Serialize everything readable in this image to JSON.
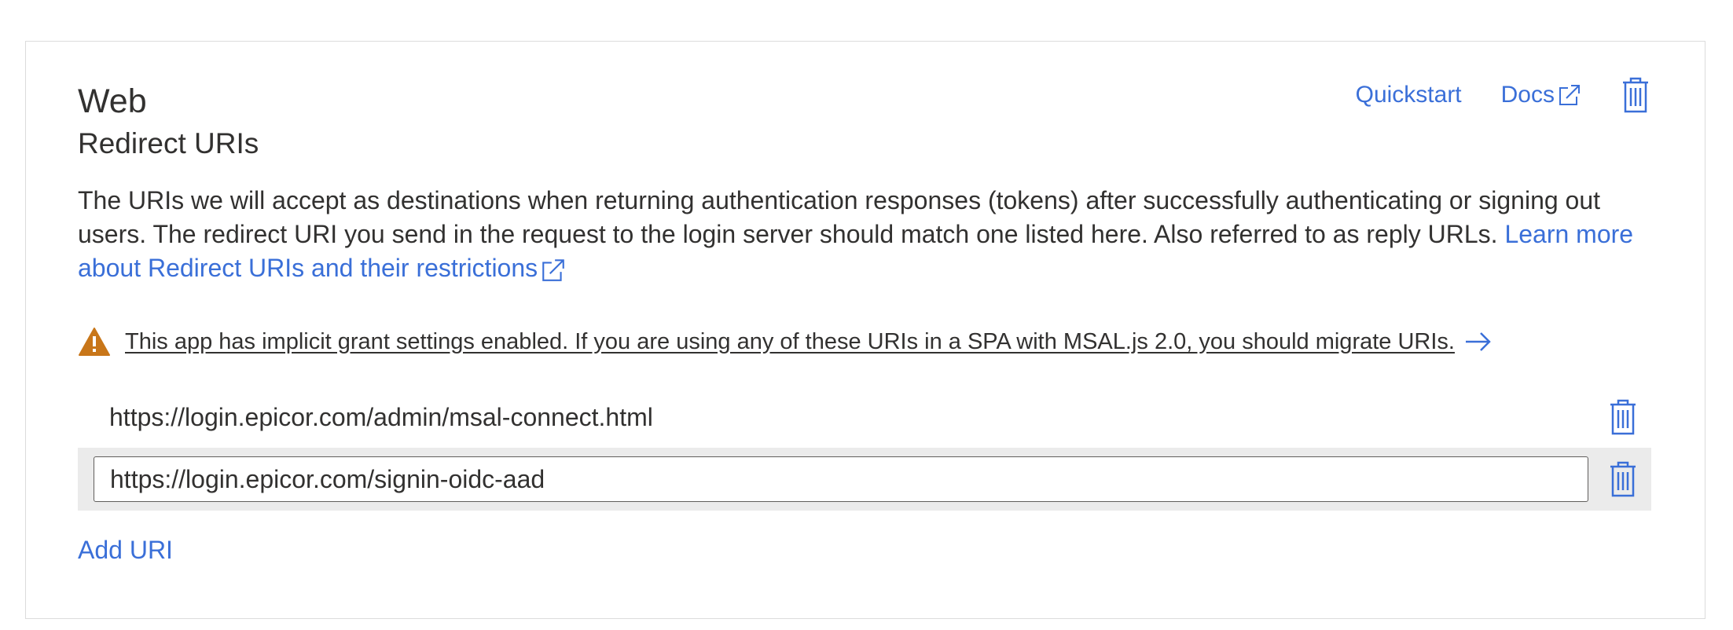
{
  "platform": {
    "title": "Web",
    "section_title": "Redirect URIs"
  },
  "header_actions": {
    "quickstart_label": "Quickstart",
    "docs_label": "Docs"
  },
  "description": {
    "text": "The URIs we will accept as destinations when returning authentication responses (tokens) after successfully authenticating or signing out users. The redirect URI you send in the request to the login server should match one listed here. Also referred to as reply URLs. ",
    "learn_more_label": "Learn more about Redirect URIs and their restrictions"
  },
  "warning": {
    "text": "This app has implicit grant settings enabled. If you are using any of these URIs in a SPA with MSAL.js 2.0, you should migrate URIs."
  },
  "redirect_uris": {
    "static": "https://login.epicor.com/admin/msal-connect.html",
    "editing": "https://login.epicor.com/signin-oidc-aad"
  },
  "add_uri_label": "Add URI",
  "colors": {
    "link": "#3a6fd8",
    "warning": "#c87619",
    "text": "#323130",
    "row_highlight": "#ebebeb"
  },
  "icons": [
    "external-link-icon",
    "trash-icon",
    "warning-icon",
    "arrow-right-icon"
  ]
}
